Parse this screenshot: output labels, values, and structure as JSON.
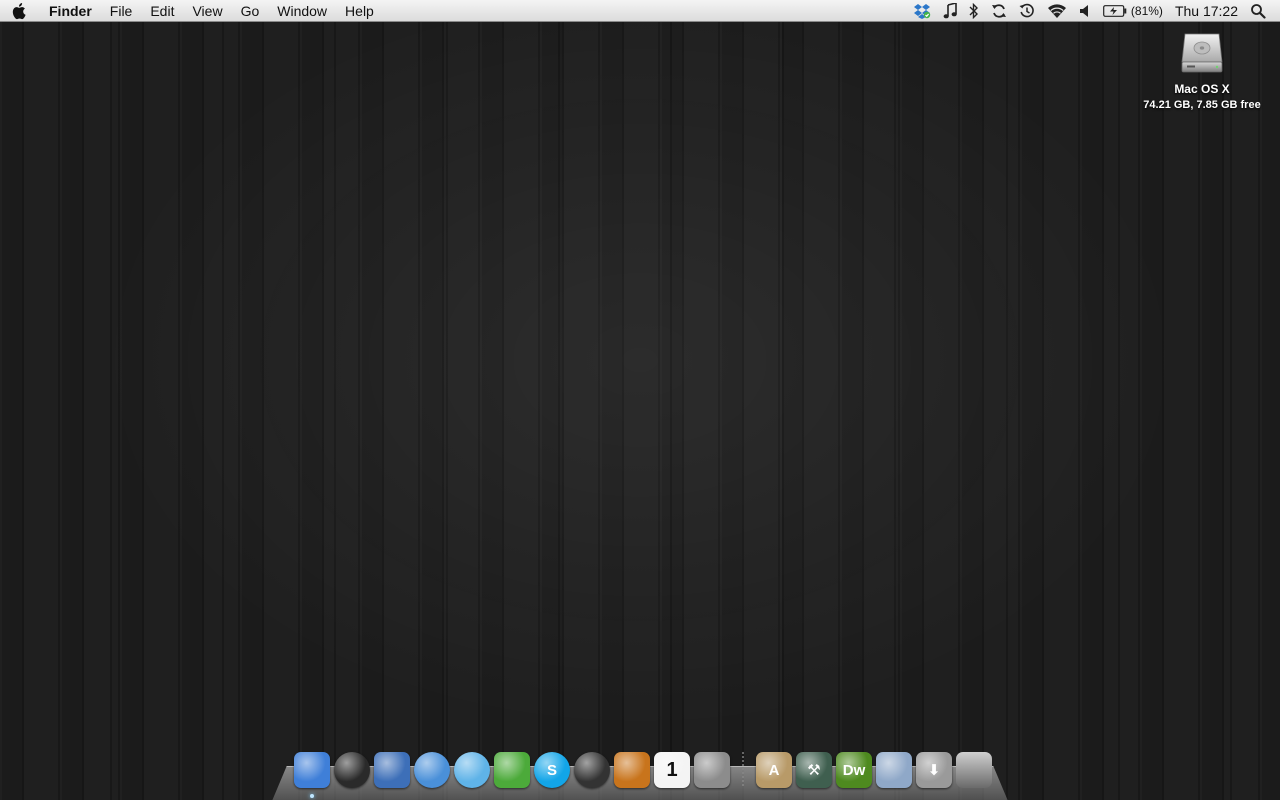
{
  "menubar": {
    "app_name": "Finder",
    "menus": [
      "File",
      "Edit",
      "View",
      "Go",
      "Window",
      "Help"
    ],
    "status": {
      "battery_percent": "(81%)",
      "clock": "Thu 17:22",
      "icons": [
        "dropbox-icon",
        "music-note-icon",
        "bluetooth-icon",
        "sync-icon",
        "time-machine-icon",
        "wifi-icon",
        "volume-icon",
        "battery-icon",
        "spotlight-icon"
      ]
    }
  },
  "desktop": {
    "drive": {
      "name": "Mac OS X",
      "info": "74.21 GB, 7.85 GB free"
    }
  },
  "dock": {
    "apps": [
      {
        "name": "finder-icon",
        "glyph": "",
        "color": "#3f7fd8",
        "running": true
      },
      {
        "name": "dashboard-icon",
        "glyph": "",
        "color": "#2a2a2a",
        "running": false
      },
      {
        "name": "mail-icon",
        "glyph": "",
        "color": "#3d6fb8",
        "running": false
      },
      {
        "name": "safari-icon",
        "glyph": "",
        "color": "#4a90d9",
        "running": false
      },
      {
        "name": "itunes-icon",
        "glyph": "",
        "color": "#5fb3e8",
        "running": false
      },
      {
        "name": "adium-icon",
        "glyph": "",
        "color": "#4caa3a",
        "running": false
      },
      {
        "name": "skype-icon",
        "glyph": "S",
        "color": "#12a5e8",
        "running": false
      },
      {
        "name": "time-machine-dock-icon",
        "glyph": "",
        "color": "#333",
        "running": false
      },
      {
        "name": "iphoto-icon",
        "glyph": "",
        "color": "#c8741c",
        "running": false
      },
      {
        "name": "ical-icon",
        "glyph": "1",
        "color": "#f4f4f4",
        "running": false
      },
      {
        "name": "system-preferences-icon",
        "glyph": "",
        "color": "#8c8c8c",
        "running": false
      }
    ],
    "stacks": [
      {
        "name": "applications-stack-icon",
        "glyph": "A",
        "color": "#b89a68"
      },
      {
        "name": "utilities-stack-icon",
        "glyph": "⚒",
        "color": "#3f5f4f"
      },
      {
        "name": "dreamweaver-icon",
        "glyph": "Dw",
        "color": "#4e8a1f"
      },
      {
        "name": "documents-folder-icon",
        "glyph": "",
        "color": "#8fa8c8"
      },
      {
        "name": "downloads-stack-icon",
        "glyph": "⬇",
        "color": "#9a9a9a"
      },
      {
        "name": "trash-icon",
        "glyph": "",
        "color": "#6a6a6a"
      }
    ]
  }
}
